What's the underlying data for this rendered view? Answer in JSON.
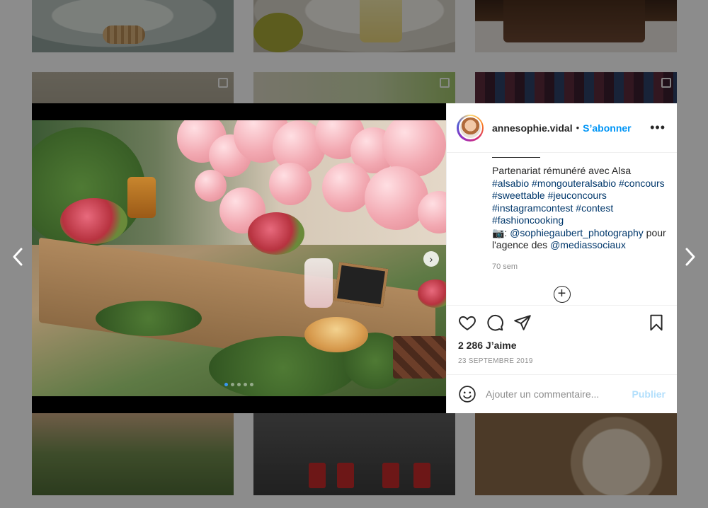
{
  "post": {
    "username": "annesophie.vidal",
    "separator": "•",
    "follow_label": "S’abonner",
    "more_label": "•••",
    "caption_lines": [
      {
        "type": "text",
        "text": "Partenariat rémunéré avec Alsa"
      },
      {
        "type": "tags",
        "text": "#alsabio #mongouteralsabio #concours"
      },
      {
        "type": "tags",
        "text": "#sweettable #jeuconcours"
      },
      {
        "type": "tags",
        "text": "#instagramcontest #contest"
      },
      {
        "type": "tags",
        "text": "#fashioncooking"
      }
    ],
    "credit_prefix": "📷: ",
    "credit_mention": "@sophiegaubert_photography",
    "credit_suffix": " pour",
    "agency_prefix": "l'agence des ",
    "agency_mention": "@mediassociaux",
    "age": "70 sem",
    "load_more_label": "+",
    "likes": "2 286 J’aime",
    "date": "23 SEPTEMBRE 2019",
    "comment_placeholder": "Ajouter un commentaire...",
    "publish_label": "Publier"
  },
  "carousel": {
    "total": 5,
    "active": 1,
    "next_label": "›"
  },
  "icons": {
    "like": "heart-icon",
    "comment": "comment-icon",
    "share": "share-icon",
    "save": "bookmark-icon",
    "emoji": "emoji-icon",
    "prev": "chevron-left-icon",
    "next": "chevron-right-icon"
  },
  "colors": {
    "link": "#00376b",
    "follow": "#0095f6",
    "publish_disabled": "#b2dffc",
    "dot_active": "#3897f0"
  }
}
